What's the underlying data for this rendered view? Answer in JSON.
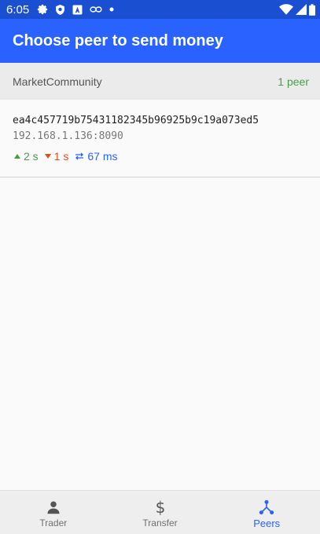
{
  "status_bar": {
    "time": "6:05",
    "icons": [
      "gear-icon",
      "shield-icon",
      "a-badge-icon",
      "link-icon",
      "dot-icon"
    ],
    "right_icons": [
      "wifi-icon",
      "signal-icon",
      "battery-icon"
    ]
  },
  "app_bar": {
    "title": "Choose peer to send money"
  },
  "section": {
    "name": "MarketCommunity",
    "count": "1 peer"
  },
  "peers": [
    {
      "id": "ea4c457719b75431182345b96925b9c19a073ed5",
      "address": "192.168.1.136:8090",
      "last_sent": "2 s",
      "last_received": "1 s",
      "ping": "67 ms"
    }
  ],
  "bottom_nav": {
    "items": [
      {
        "label": "Trader",
        "icon": "person-icon"
      },
      {
        "label": "Transfer",
        "icon": "dollar-icon"
      },
      {
        "label": "Peers",
        "icon": "peers-network-icon"
      }
    ],
    "active": "Peers"
  },
  "colors": {
    "status_bar": "#1a4fd1",
    "app_bar": "#2962ff",
    "up": "#43a047",
    "down": "#e64a19",
    "ping": "#2962ff"
  }
}
